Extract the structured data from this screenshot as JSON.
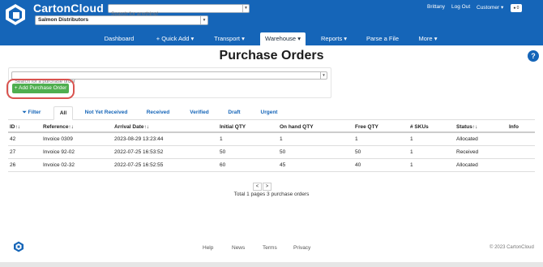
{
  "header": {
    "brand": "CartonCloud",
    "search_placeholder": "Search for anything!",
    "organization": "Salmon Distributors",
    "user_name": "Brittany",
    "logout_label": "Log Out",
    "customer_label": "Customer",
    "notification_count": "0"
  },
  "nav": {
    "items": [
      "Dashboard",
      "+ Quick Add",
      "Transport",
      "Warehouse",
      "Reports",
      "Parse a File",
      "More"
    ],
    "active": "Warehouse"
  },
  "page": {
    "title": "Purchase Orders",
    "help_label": "?",
    "po_search_placeholder": "Search for a purchase order",
    "add_button_label": "+ Add Purchase Order"
  },
  "tabs": {
    "filter_label": "Filter",
    "items": [
      "All",
      "Not Yet Received",
      "Received",
      "Verified",
      "Draft",
      "Urgent"
    ],
    "active": "All"
  },
  "table": {
    "columns": [
      "ID↑↓",
      "Reference↑↓",
      "Arrival Date↑↓",
      "Initial QTY",
      "On hand QTY",
      "Free QTY",
      "# SKUs",
      "Status↑↓",
      "Info"
    ],
    "rows": [
      [
        "42",
        "Invoice 0309",
        "2023-08-29 13:23:44",
        "1",
        "1",
        "1",
        "1",
        "Allocated",
        ""
      ],
      [
        "27",
        "Invoice 92-02",
        "2022-07-25 16:53:52",
        "50",
        "50",
        "50",
        "1",
        "Received",
        ""
      ],
      [
        "26",
        "Invoice 02-32",
        "2022-07-25 16:52:55",
        "60",
        "45",
        "40",
        "1",
        "Allocated",
        ""
      ]
    ]
  },
  "pagination": {
    "prev": "<",
    "next": ">",
    "summary": "Total 1 pages 3 purchase orders"
  },
  "footer": {
    "links": [
      "Help",
      "News",
      "Terms",
      "Privacy"
    ],
    "copyright": "© 2023 CartonCloud"
  },
  "colors": {
    "brand_blue": "#1565b8",
    "success_green": "#4fae4f",
    "highlight_red": "#d9534f"
  }
}
